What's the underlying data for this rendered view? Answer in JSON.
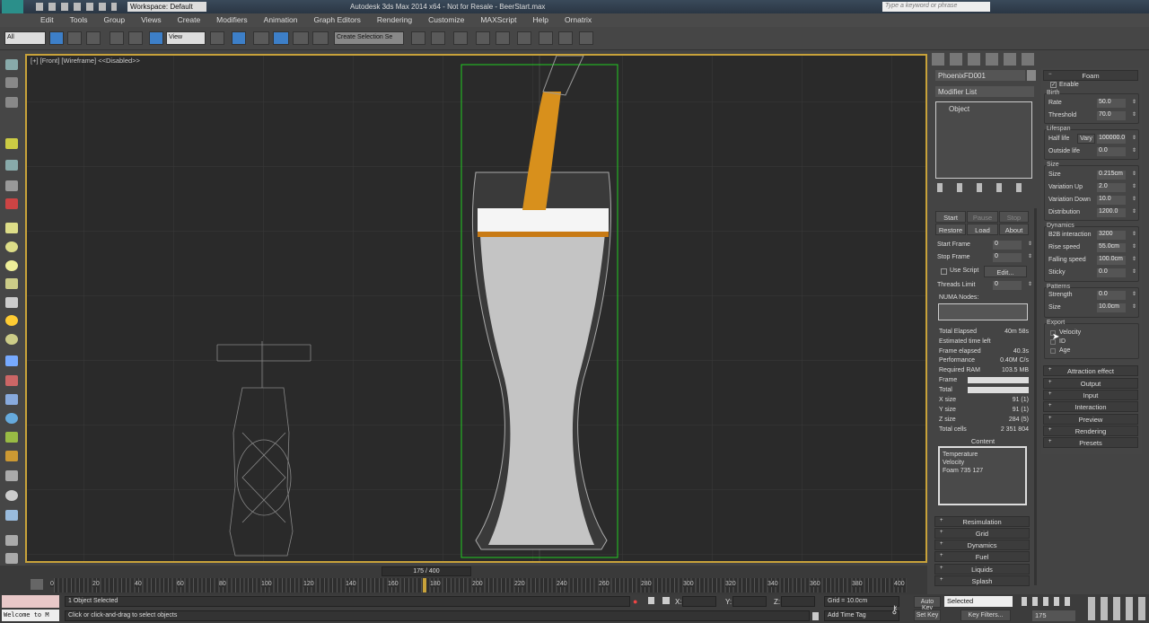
{
  "titlebar": {
    "app_title": "Autodesk 3ds Max 2014 x64 - Not for Resale - BeerStart.max",
    "workspace": "Workspace: Default",
    "search_placeholder": "Type a keyword or phrase"
  },
  "menu": [
    "Edit",
    "Tools",
    "Group",
    "Views",
    "Create",
    "Modifiers",
    "Animation",
    "Graph Editors",
    "Rendering",
    "Customize",
    "MAXScript",
    "Help",
    "Ornatrix"
  ],
  "toolbar": {
    "filter": "All",
    "coord": "View",
    "selection_set": "Create Selection Se"
  },
  "viewport": {
    "label": "[+] [Front] [Wireframe]  <<Disabled>>"
  },
  "command_panel": {
    "object_name": "PhoenixFD001",
    "modifier_list": "Modifier List",
    "stack_item": "Object",
    "buttons": [
      "Start",
      "Pause",
      "Stop",
      "Restore",
      "Load",
      "About"
    ],
    "start_frame_label": "Start Frame",
    "start_frame": "0",
    "stop_frame_label": "Stop Frame",
    "stop_frame": "0",
    "use_script": "Use Script",
    "edit": "Edit...",
    "threads_label": "Threads Limit",
    "threads": "0",
    "numa": "NUMA Nodes:",
    "stats": [
      {
        "k": "Total Elapsed",
        "v": "40m 58s"
      },
      {
        "k": "Estimated time left",
        "v": ""
      },
      {
        "k": "Frame elapsed",
        "v": "40.3s"
      },
      {
        "k": "Performance",
        "v": "0.40M C/s"
      },
      {
        "k": "Required RAM",
        "v": "103.5 MB"
      }
    ],
    "frame_label": "Frame",
    "total_label": "Total",
    "frame_progress": 1.0,
    "total_progress": 1.0,
    "sizes": [
      {
        "k": "X size",
        "v": "91 (1)"
      },
      {
        "k": "Y size",
        "v": "91 (1)"
      },
      {
        "k": "Z size",
        "v": "284 (5)"
      },
      {
        "k": "Total cells",
        "v": "2 351 804"
      }
    ],
    "content_label": "Content",
    "content": [
      "Temperature",
      "Velocity",
      "Foam  735 127"
    ],
    "rollups": [
      "Resimulation",
      "Grid",
      "Dynamics",
      "Fuel",
      "Liquids",
      "Splash"
    ]
  },
  "foam": {
    "title": "Foam",
    "enable": "Enable",
    "birth": "Birth",
    "rate_label": "Rate",
    "rate": "50.0",
    "threshold_label": "Threshold",
    "threshold": "70.0",
    "lifespan": "Lifespan",
    "half_life_label": "Half life",
    "vary": "Vary",
    "half_life": "100000.0",
    "outside_label": "Outside life",
    "outside": "0.0",
    "size_group": "Size",
    "size_label": "Size",
    "size": "0.215cm",
    "var_up_label": "Variation Up",
    "var_up": "2.0",
    "var_down_label": "Variation Down",
    "var_down": "10.0",
    "dist_label": "Distribution",
    "dist": "1200.0",
    "dynamics": "Dynamics",
    "b2b_label": "B2B interaction",
    "b2b": "3200",
    "rise_label": "Rise speed",
    "rise": "55.0cm",
    "fall_label": "Falling speed",
    "fall": "100.0cm",
    "sticky_label": "Sticky",
    "sticky": "0.0",
    "patterns": "Patterns",
    "strength_label": "Strength",
    "strength": "0.0",
    "psize_label": "Size",
    "psize": "10.0cm",
    "export": "Export",
    "velocity": "Velocity",
    "id": "ID",
    "age": "Age",
    "rollups": [
      "Attraction effect",
      "Output",
      "Input",
      "Interaction",
      "Preview",
      "Rendering",
      "Presets"
    ]
  },
  "timeline": {
    "frame": "175 / 400",
    "ticks": [
      "0",
      "20",
      "40",
      "60",
      "80",
      "100",
      "120",
      "140",
      "160",
      "180",
      "200",
      "220",
      "240",
      "260",
      "280",
      "300",
      "320",
      "340",
      "360",
      "380",
      "400"
    ],
    "current": 175,
    "max": 400
  },
  "status": {
    "welcome": "Welcome to M",
    "selected": "1 Object Selected",
    "prompt": "Click or click-and-drag to select objects",
    "x": "X:",
    "y": "Y:",
    "z": "Z:",
    "grid": "Grid = 10.0cm",
    "add_time_tag": "Add Time Tag",
    "auto_key": "Auto Key",
    "set_key": "Set Key",
    "key_mode": "Selected",
    "key_filters": "Key Filters...",
    "frame": "175"
  }
}
